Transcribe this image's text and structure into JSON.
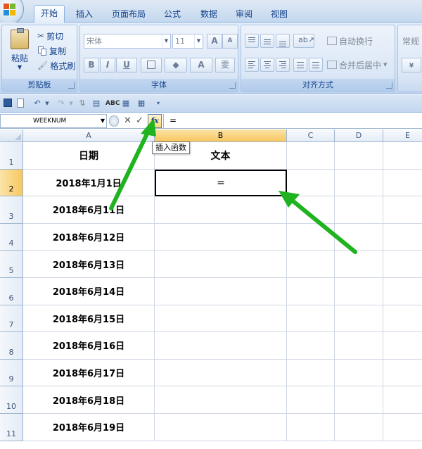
{
  "ribbon": {
    "tabs": [
      {
        "label": "开始",
        "active": true
      },
      {
        "label": "插入",
        "active": false
      },
      {
        "label": "页面布局",
        "active": false
      },
      {
        "label": "公式",
        "active": false
      },
      {
        "label": "数据",
        "active": false
      },
      {
        "label": "审阅",
        "active": false
      },
      {
        "label": "视图",
        "active": false
      }
    ],
    "clipboard": {
      "paste_label": "粘贴",
      "cut_label": "剪切",
      "copy_label": "复制",
      "format_painter_label": "格式刷",
      "group_label": "剪贴板"
    },
    "font": {
      "font_name": "宋体",
      "font_size": "11",
      "grow_label": "A",
      "shrink_label": "A",
      "bold_label": "B",
      "italic_label": "I",
      "underline_label": "U",
      "font_color_label": "A",
      "phonetic_label": "雯",
      "group_label": "字体"
    },
    "alignment": {
      "wrap_text_label": "自动换行",
      "merge_center_label": "合并后居中",
      "group_label": "对齐方式"
    },
    "number": {
      "format_label": "常规"
    }
  },
  "formula_bar": {
    "name_box": "WEEKNUM",
    "insert_function_label": "fx",
    "formula": "="
  },
  "tooltip": "插入函数",
  "columns": [
    "A",
    "B",
    "C",
    "D",
    "E"
  ],
  "selected_column": "B",
  "rows": [
    {
      "num": "1",
      "a": "日期",
      "b": "文本"
    },
    {
      "num": "2",
      "a": "2018年1月1日",
      "b": "="
    },
    {
      "num": "3",
      "a": "2018年6月11日",
      "b": ""
    },
    {
      "num": "4",
      "a": "2018年6月12日",
      "b": ""
    },
    {
      "num": "5",
      "a": "2018年6月13日",
      "b": ""
    },
    {
      "num": "6",
      "a": "2018年6月14日",
      "b": ""
    },
    {
      "num": "7",
      "a": "2018年6月15日",
      "b": ""
    },
    {
      "num": "8",
      "a": "2018年6月16日",
      "b": ""
    },
    {
      "num": "9",
      "a": "2018年6月17日",
      "b": ""
    },
    {
      "num": "10",
      "a": "2018年6月18日",
      "b": ""
    },
    {
      "num": "11",
      "a": "2018年6月19日",
      "b": ""
    }
  ],
  "selected_row": "2",
  "annotation_color": "#1fb31f"
}
